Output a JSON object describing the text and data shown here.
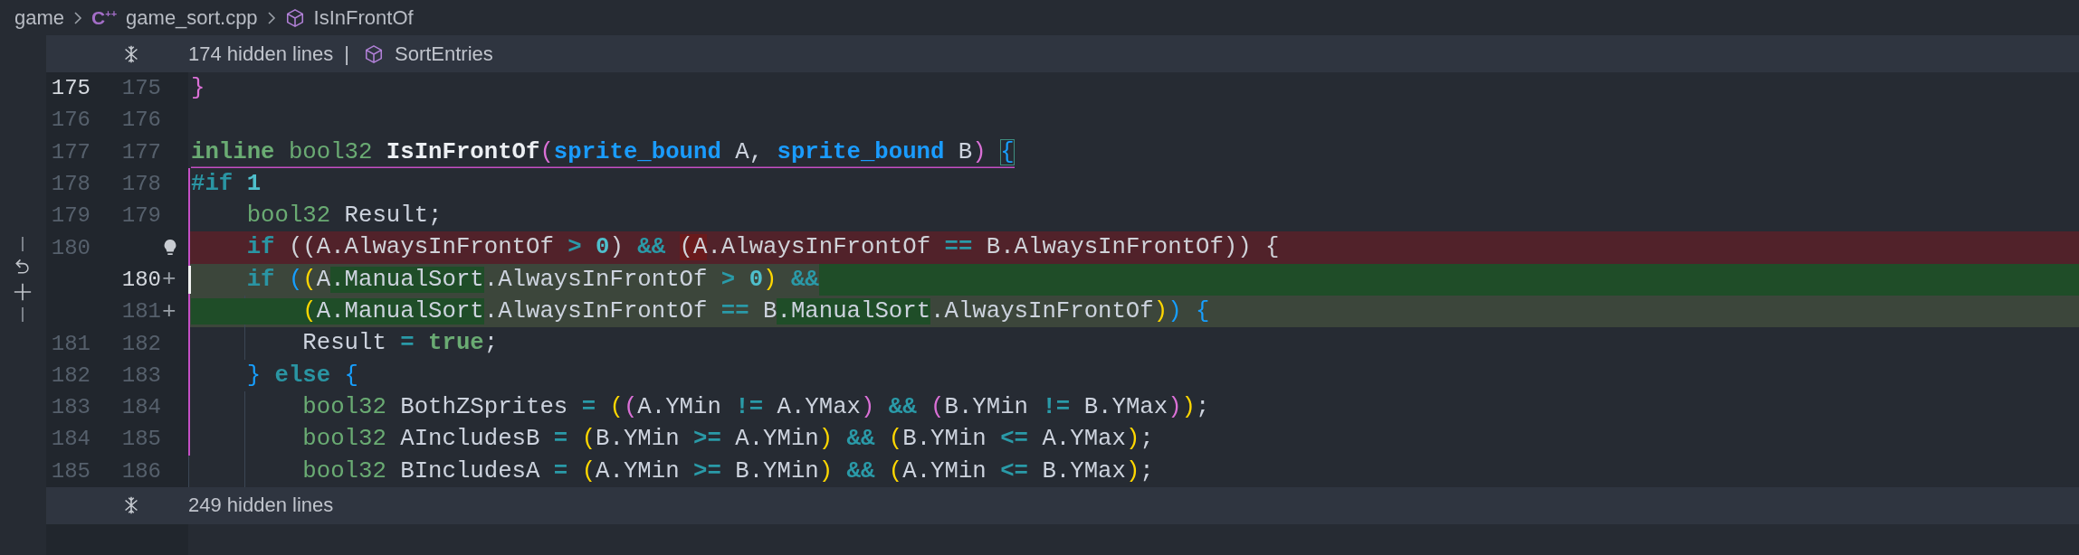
{
  "breadcrumb": {
    "folder": "game",
    "file_icon": "C$^{++}$",
    "file": "game_sort.cpp",
    "symbol": "IsInFrontOf"
  },
  "rows": [
    {
      "kind": "fold",
      "text": "174 hidden lines",
      "separator": "|",
      "symbol": "SortEntries"
    },
    {
      "kind": "code",
      "old": "175",
      "new": "175",
      "old_active": true,
      "new_active": false,
      "tokens": [
        {
          "t": "}",
          "kind": "b2"
        }
      ]
    },
    {
      "kind": "code",
      "old": "176",
      "new": "176",
      "old_active": false,
      "new_active": false,
      "tokens": []
    },
    {
      "kind": "code",
      "old": "177",
      "new": "177",
      "old_active": false,
      "new_active": false,
      "scope_open": true,
      "tokens": [
        {
          "t": "inline",
          "kind": "kw2"
        },
        {
          "t": " bool32",
          "kind": "ty"
        },
        {
          "t": " IsInFrontOf",
          "kind": "fn"
        },
        {
          "t": "(",
          "kind": "b2"
        },
        {
          "t": "sprite_bound",
          "kind": "pt"
        },
        {
          "t": " A,",
          "kind": "p"
        },
        {
          "t": " sprite_bound",
          "kind": "pt"
        },
        {
          "t": " B",
          "kind": "p"
        },
        {
          "t": ") ",
          "kind": "b2"
        },
        {
          "t": "{",
          "kind": "b3",
          "box": true
        }
      ]
    },
    {
      "kind": "code",
      "old": "178",
      "new": "178",
      "old_active": false,
      "new_active": false,
      "scope": true,
      "tokens": [
        {
          "t": "#if",
          "kind": "kw"
        },
        {
          "t": " 1",
          "kind": "num"
        }
      ]
    },
    {
      "kind": "code",
      "old": "179",
      "new": "179",
      "old_active": false,
      "new_active": false,
      "scope": true,
      "tokens": [
        {
          "t": "    bool32",
          "kind": "ty"
        },
        {
          "t": " Result;",
          "kind": "p"
        }
      ]
    },
    {
      "kind": "deleted",
      "old": "180",
      "old_active": false,
      "scope": true,
      "lightbulb": true,
      "hunk_actions": true,
      "tokens": [
        {
          "t": "    if",
          "kind": "kw"
        },
        {
          "t": " ((A.AlwaysInFrontOf ",
          "kind": "p"
        },
        {
          "t": ">",
          "kind": "op"
        },
        {
          "t": " 0",
          "kind": "num"
        },
        {
          "t": ") ",
          "kind": "p"
        },
        {
          "t": "&& ",
          "kind": "op"
        },
        {
          "t": "(A",
          "kind": "p",
          "changed": true
        },
        {
          "t": ".AlwaysInFrontOf ",
          "kind": "p"
        },
        {
          "t": "==",
          "kind": "op"
        },
        {
          "t": " B.AlwaysInFrontOf)) {",
          "kind": "p"
        }
      ]
    },
    {
      "kind": "inserted",
      "new": "180",
      "marker": "+",
      "new_active": true,
      "scope": true,
      "cursor": true,
      "tail_mark": true,
      "tokens": [
        {
          "t": "    if",
          "kind": "kw"
        },
        {
          "t": " (",
          "kind": "b3"
        },
        {
          "t": "(",
          "kind": "b1"
        },
        {
          "t": "A",
          "kind": "p"
        },
        {
          "t": ".ManualSort",
          "kind": "p",
          "changed": true
        },
        {
          "t": ".AlwaysInFrontOf ",
          "kind": "p"
        },
        {
          "t": ">",
          "kind": "op"
        },
        {
          "t": " 0",
          "kind": "num"
        },
        {
          "t": ")",
          "kind": "b1"
        },
        {
          "t": " &&",
          "kind": "op"
        }
      ]
    },
    {
      "kind": "inserted",
      "new": "181",
      "marker": "+",
      "new_active": false,
      "scope": true,
      "tail_mark": false,
      "tokens": [
        {
          "t": "        (",
          "kind": "b1",
          "changed": true
        },
        {
          "t": "A.ManualSort",
          "kind": "p",
          "changed": true
        },
        {
          "t": ".AlwaysInFrontOf ",
          "kind": "p"
        },
        {
          "t": "==",
          "kind": "op"
        },
        {
          "t": " B",
          "kind": "p"
        },
        {
          "t": ".ManualSort",
          "kind": "p",
          "changed": true
        },
        {
          "t": ".AlwaysInFrontOf",
          "kind": "p"
        },
        {
          "t": ")",
          "kind": "b1"
        },
        {
          "t": ")",
          "kind": "b3"
        },
        {
          "t": " {",
          "kind": "b3"
        }
      ]
    },
    {
      "kind": "code",
      "old": "181",
      "new": "182",
      "old_active": false,
      "new_active": false,
      "scope": true,
      "tokens": [
        {
          "t": "        Result ",
          "kind": "p"
        },
        {
          "t": "=",
          "kind": "op"
        },
        {
          "t": " true",
          "kind": "kw2"
        },
        {
          "t": ";",
          "kind": "p"
        }
      ]
    },
    {
      "kind": "code",
      "old": "182",
      "new": "183",
      "old_active": false,
      "new_active": false,
      "scope": true,
      "tokens": [
        {
          "t": "    }",
          "kind": "b3"
        },
        {
          "t": " else",
          "kind": "kw"
        },
        {
          "t": " {",
          "kind": "b3"
        }
      ]
    },
    {
      "kind": "code",
      "old": "183",
      "new": "184",
      "old_active": false,
      "new_active": false,
      "scope": true,
      "tokens": [
        {
          "t": "        bool32",
          "kind": "ty"
        },
        {
          "t": " BothZSprites ",
          "kind": "p"
        },
        {
          "t": "=",
          "kind": "op"
        },
        {
          "t": " (",
          "kind": "b1"
        },
        {
          "t": "(",
          "kind": "b2"
        },
        {
          "t": "A.YMin ",
          "kind": "p"
        },
        {
          "t": "!=",
          "kind": "op"
        },
        {
          "t": " A.YMax",
          "kind": "p"
        },
        {
          "t": ")",
          "kind": "b2"
        },
        {
          "t": " &&",
          "kind": "op"
        },
        {
          "t": " (",
          "kind": "b2"
        },
        {
          "t": "B.YMin ",
          "kind": "p"
        },
        {
          "t": "!=",
          "kind": "op"
        },
        {
          "t": " B.YMax",
          "kind": "p"
        },
        {
          "t": ")",
          "kind": "b2"
        },
        {
          "t": ")",
          "kind": "b1"
        },
        {
          "t": ";",
          "kind": "p"
        }
      ]
    },
    {
      "kind": "code",
      "old": "184",
      "new": "185",
      "old_active": false,
      "new_active": false,
      "scope": true,
      "tokens": [
        {
          "t": "        bool32",
          "kind": "ty"
        },
        {
          "t": " AIncludesB ",
          "kind": "p"
        },
        {
          "t": "=",
          "kind": "op"
        },
        {
          "t": " (",
          "kind": "b1"
        },
        {
          "t": "B.YMin ",
          "kind": "p"
        },
        {
          "t": ">=",
          "kind": "op"
        },
        {
          "t": " A.YMin",
          "kind": "p"
        },
        {
          "t": ")",
          "kind": "b1"
        },
        {
          "t": " &&",
          "kind": "op"
        },
        {
          "t": " (",
          "kind": "b1"
        },
        {
          "t": "B.YMin ",
          "kind": "p"
        },
        {
          "t": "<=",
          "kind": "op"
        },
        {
          "t": " A.YMax",
          "kind": "p"
        },
        {
          "t": ")",
          "kind": "b1"
        },
        {
          "t": ";",
          "kind": "p"
        }
      ]
    },
    {
      "kind": "code",
      "old": "185",
      "new": "186",
      "old_active": false,
      "new_active": false,
      "tokens": [
        {
          "t": "        bool32",
          "kind": "ty"
        },
        {
          "t": " BIncludesA ",
          "kind": "p"
        },
        {
          "t": "=",
          "kind": "op"
        },
        {
          "t": " (",
          "kind": "b1"
        },
        {
          "t": "A.YMin ",
          "kind": "p"
        },
        {
          "t": ">=",
          "kind": "op"
        },
        {
          "t": " B.YMin",
          "kind": "p"
        },
        {
          "t": ")",
          "kind": "b1"
        },
        {
          "t": " &&",
          "kind": "op"
        },
        {
          "t": " (",
          "kind": "b1"
        },
        {
          "t": "A.YMin ",
          "kind": "p"
        },
        {
          "t": "<=",
          "kind": "op"
        },
        {
          "t": " B.YMax",
          "kind": "p"
        },
        {
          "t": ")",
          "kind": "b1"
        },
        {
          "t": ";",
          "kind": "p"
        }
      ]
    },
    {
      "kind": "fold",
      "text": "249 hidden lines"
    }
  ]
}
